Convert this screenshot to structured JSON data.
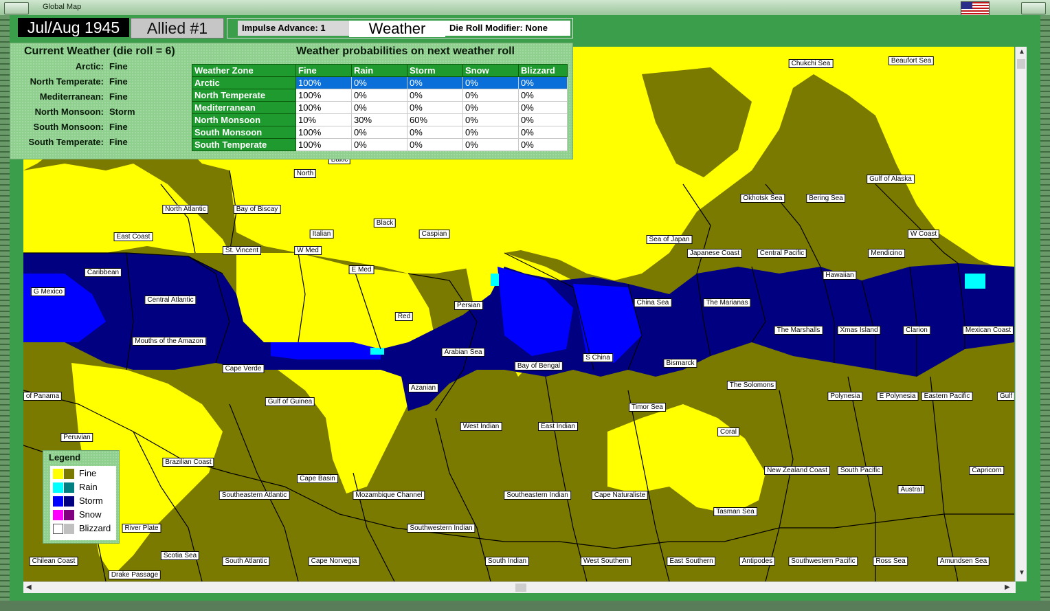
{
  "window": {
    "title": "Global Map"
  },
  "top_bar": {
    "date": "Jul/Aug 1945",
    "side": "Allied #1",
    "impulse_advance": "Impulse Advance:  1",
    "weather_label": "Weather",
    "die_roll_modifier": "Die Roll Modifier:  None"
  },
  "current_weather": {
    "title": "Current Weather (die roll = 6)",
    "zones": [
      {
        "name": "Arctic:",
        "value": "Fine"
      },
      {
        "name": "North Temperate:",
        "value": "Fine"
      },
      {
        "name": "Mediterranean:",
        "value": "Fine"
      },
      {
        "name": "North Monsoon:",
        "value": "Storm"
      },
      {
        "name": "South Monsoon:",
        "value": "Fine"
      },
      {
        "name": "South Temperate:",
        "value": "Fine"
      }
    ]
  },
  "probabilities": {
    "title": "Weather probabilities on next weather roll",
    "headers": [
      "Weather Zone",
      "Fine",
      "Rain",
      "Storm",
      "Snow",
      "Blizzard"
    ],
    "rows": [
      [
        "Arctic",
        "100%",
        "0%",
        "0%",
        "0%",
        "0%"
      ],
      [
        "North Temperate",
        "100%",
        "0%",
        "0%",
        "0%",
        "0%"
      ],
      [
        "Mediterranean",
        "100%",
        "0%",
        "0%",
        "0%",
        "0%"
      ],
      [
        "North Monsoon",
        "10%",
        "30%",
        "60%",
        "0%",
        "0%"
      ],
      [
        "South Monsoon",
        "100%",
        "0%",
        "0%",
        "0%",
        "0%"
      ],
      [
        "South Temperate",
        "100%",
        "0%",
        "0%",
        "0%",
        "0%"
      ]
    ],
    "selected_row": 0
  },
  "legend": {
    "title": "Legend",
    "items": [
      {
        "label": "Fine",
        "land": "#ffff00",
        "sea": "#7a7a00"
      },
      {
        "label": "Rain",
        "land": "#00ffff",
        "sea": "#008080"
      },
      {
        "label": "Storm",
        "land": "#0000ff",
        "sea": "#000080"
      },
      {
        "label": "Snow",
        "land": "#ff00ff",
        "sea": "#800080"
      },
      {
        "label": "Blizzard",
        "land": "#ffffff",
        "sea": "#c0c0c0"
      }
    ]
  },
  "map_labels": [
    "Chukchi Sea",
    "Beaufort Sea",
    "Baltic",
    "North",
    "North Atlantic",
    "Bay of Biscay",
    "Black",
    "Gulf of Alaska",
    "Okhotsk Sea",
    "Bering Sea",
    "East Coast",
    "Italian",
    "Caspian",
    "Sea of Japan",
    "W Coast",
    "St. Vincent",
    "W Med",
    "Japanese Coast",
    "Central Pacific",
    "Mendicino",
    "E Med",
    "Caribbean",
    "Hawaiian",
    "G Mexico",
    "Central Atlantic",
    "Persian",
    "China Sea",
    "The Marianas",
    "Red",
    "Mouths of the Amazon",
    "The Marshalls",
    "Xmas Island",
    "Clarion",
    "Mexican Coast",
    "Arabian Sea",
    "S China",
    "Bismarck",
    "Cape Verde",
    "Bay of Bengal",
    "Azanian",
    "The Solomons",
    "of Panama",
    "Polynesia",
    "E Polynesia",
    "Eastern Pacific",
    "Gulf",
    "Gulf of Guinea",
    "Timor Sea",
    "West Indian",
    "East Indian",
    "Peruvian",
    "Coral",
    "Brazilian Coast",
    "New Zealand Coast",
    "South Pacific",
    "Capricorn",
    "Cape Basin",
    "Austral",
    "Southeastern Atlantic",
    "Mozambique Channel",
    "Southeastern Indian",
    "Cape Naturaliste",
    "Tasman Sea",
    "River Plate",
    "Southwestern Indian",
    "Scotia Sea",
    "Chilean Coast",
    "South Atlantic",
    "Cape Norvegia",
    "South Indian",
    "West Southern",
    "East Southern",
    "Antipodes",
    "Southwestern Pacific",
    "Ross Sea",
    "Amundsen Sea",
    "Drake Passage"
  ]
}
